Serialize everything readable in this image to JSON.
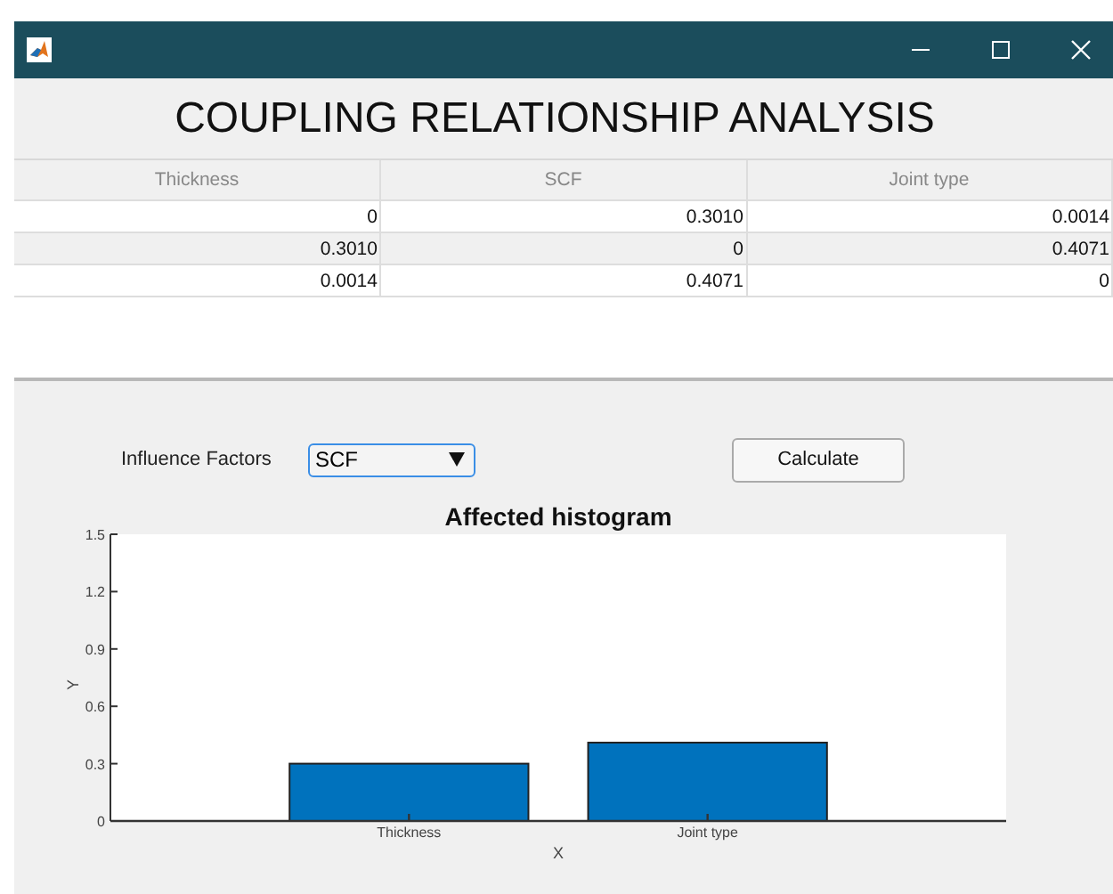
{
  "header": {
    "title": "COUPLING RELATIONSHIP ANALYSIS"
  },
  "table": {
    "columns": [
      "Thickness",
      "SCF",
      "Joint type"
    ],
    "rows": [
      [
        "0",
        "0.3010",
        "0.0014"
      ],
      [
        "0.3010",
        "0",
        "0.4071"
      ],
      [
        "0.0014",
        "0.4071",
        "0"
      ]
    ]
  },
  "controls": {
    "label": "Influence Factors",
    "dropdown": {
      "value": "SCF"
    },
    "button": "Calculate"
  },
  "chart": {
    "chart_data": {
      "type": "bar",
      "title": "Affected histogram",
      "xlabel": "X",
      "ylabel": "Y",
      "categories": [
        "Thickness",
        "Joint type"
      ],
      "values": [
        0.3,
        0.41
      ],
      "ylim": [
        0,
        1.5
      ],
      "yticks": [
        0,
        0.3,
        0.6,
        0.9,
        1.2,
        1.5
      ]
    }
  }
}
